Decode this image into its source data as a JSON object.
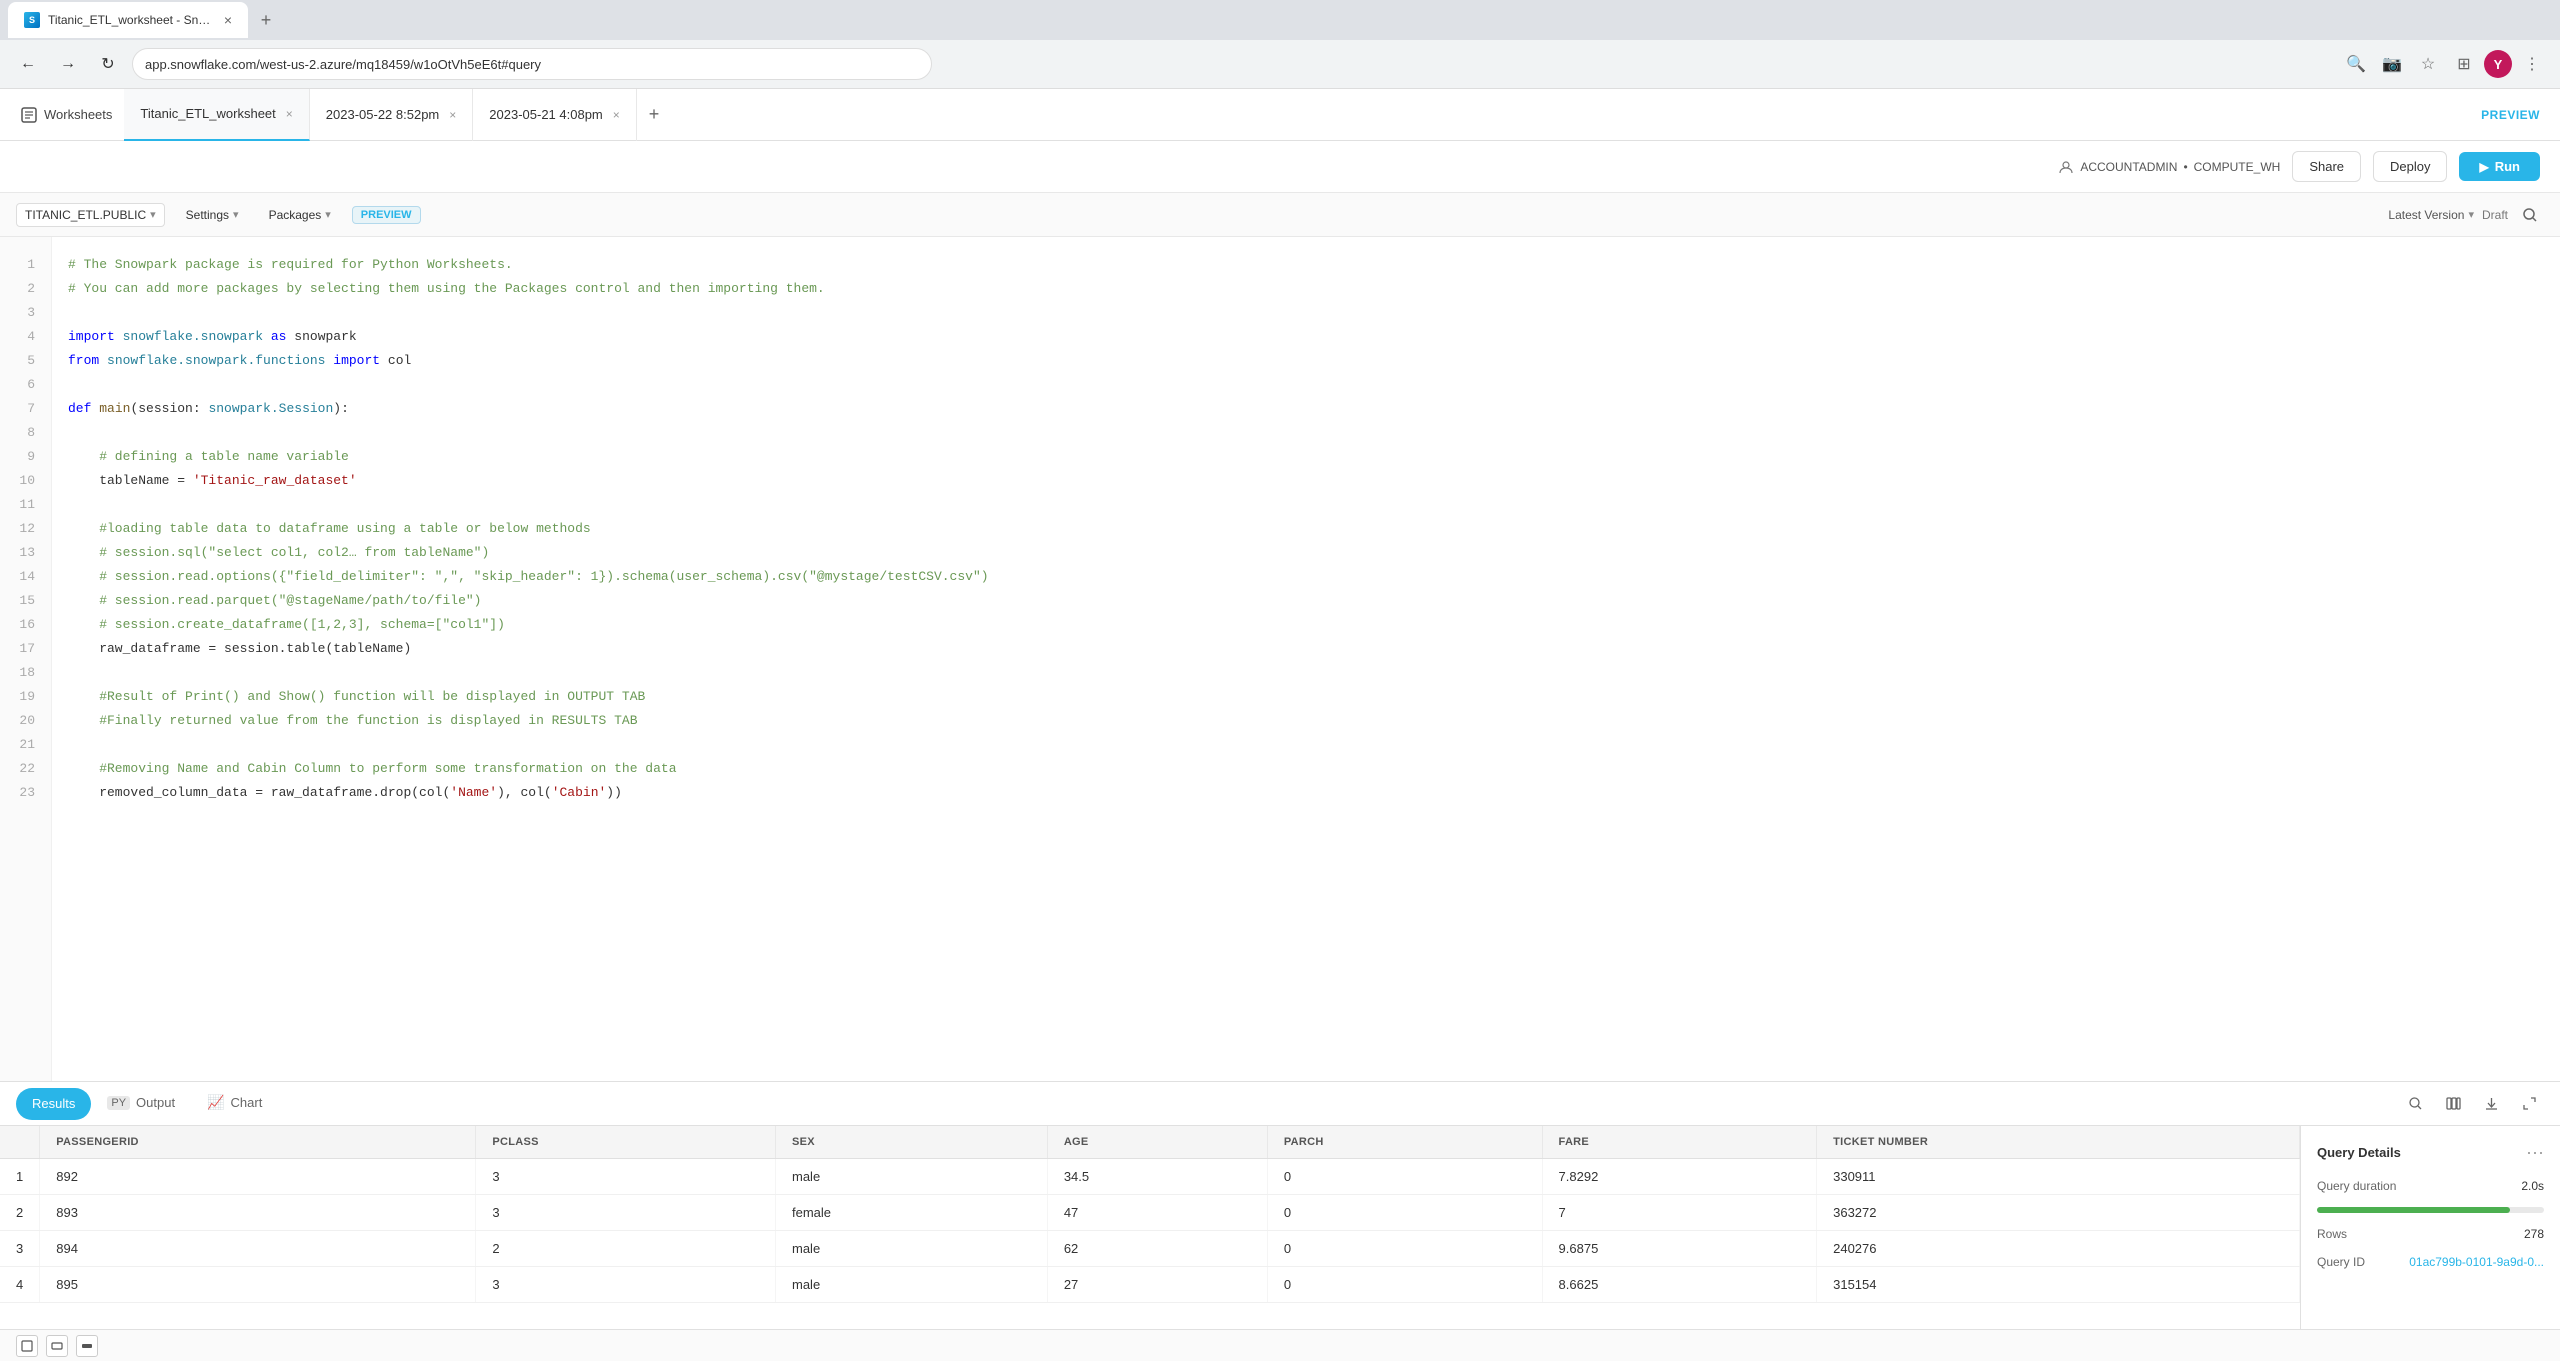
{
  "browser": {
    "tab_title": "Titanic_ETL_worksheet - Snowfla...",
    "tab_close": "×",
    "new_tab": "+",
    "url": "app.snowflake.com/west-us-2.azure/mq18459/w1oOtVh5eE6t#query",
    "nav_back": "←",
    "nav_forward": "→",
    "nav_refresh": "↻"
  },
  "app_toolbar": {
    "worksheets_label": "Worksheets",
    "tab1_label": "Titanic_ETL_worksheet",
    "tab2_label": "2023-05-22 8:52pm",
    "tab3_label": "2023-05-21 4:08pm",
    "add_tab": "+",
    "preview_label": "PREVIEW"
  },
  "action_bar": {
    "role": "ACCOUNTADMIN",
    "separator": "•",
    "warehouse": "COMPUTE_WH",
    "share_label": "Share",
    "deploy_label": "Deploy",
    "run_label": "Run",
    "run_icon": "▶"
  },
  "editor_toolbar": {
    "schema": "TITANIC_ETL.PUBLIC",
    "settings": "Settings",
    "packages": "Packages",
    "preview_badge": "PREVIEW",
    "version_label": "Latest Version",
    "draft_label": "Draft"
  },
  "code": {
    "lines": [
      {
        "num": 1,
        "text": "# The Snowpark package is required for Python Worksheets.",
        "type": "comment"
      },
      {
        "num": 2,
        "text": "# You can add more packages by selecting them using the Packages control and then importing them.",
        "type": "comment"
      },
      {
        "num": 3,
        "text": "",
        "type": "normal"
      },
      {
        "num": 4,
        "text": "import snowflake.snowpark as snowpark",
        "type": "import"
      },
      {
        "num": 5,
        "text": "from snowflake.snowpark.functions import col",
        "type": "import"
      },
      {
        "num": 6,
        "text": "",
        "type": "normal"
      },
      {
        "num": 7,
        "text": "def main(session: snowpark.Session):",
        "type": "def"
      },
      {
        "num": 8,
        "text": "",
        "type": "normal"
      },
      {
        "num": 9,
        "text": "    # defining a table name variable",
        "type": "comment"
      },
      {
        "num": 10,
        "text": "    tableName = 'Titanic_raw_dataset'",
        "type": "normal"
      },
      {
        "num": 11,
        "text": "",
        "type": "normal"
      },
      {
        "num": 12,
        "text": "    #loading table data to dataframe using a table or below methods",
        "type": "comment"
      },
      {
        "num": 13,
        "text": "    # session.sql(\"select col1, col2… from tableName\")",
        "type": "comment"
      },
      {
        "num": 14,
        "text": "    # session.read.options({\"field_delimiter\": \",\", \"skip_header\": 1}).schema(user_schema).csv(\"@mystage/testCSV.csv\")",
        "type": "comment"
      },
      {
        "num": 15,
        "text": "    # session.read.parquet(\"@stageName/path/to/file\")",
        "type": "comment"
      },
      {
        "num": 16,
        "text": "    # session.create_dataframe([1,2,3], schema=[\"col1\"])",
        "type": "comment"
      },
      {
        "num": 17,
        "text": "    raw_dataframe = session.table(tableName)",
        "type": "normal"
      },
      {
        "num": 18,
        "text": "",
        "type": "normal"
      },
      {
        "num": 19,
        "text": "    #Result of Print() and Show() function will be displayed in OUTPUT TAB",
        "type": "comment"
      },
      {
        "num": 20,
        "text": "    #Finally returned value from the function is displayed in RESULTS TAB",
        "type": "comment"
      },
      {
        "num": 21,
        "text": "",
        "type": "normal"
      },
      {
        "num": 22,
        "text": "    #Removing Name and Cabin Column to perform some transformation on the data",
        "type": "comment"
      },
      {
        "num": 23,
        "text": "    removed_column_data = raw_dataframe.drop(col('Name'), col('Cabin'))",
        "type": "normal"
      }
    ]
  },
  "results_tabs": {
    "results_label": "Results",
    "output_label": "Output",
    "output_icon": "PY",
    "chart_label": "Chart",
    "chart_icon": "📈"
  },
  "table": {
    "columns": [
      "PASSENGERID",
      "PCLASS",
      "SEX",
      "AGE",
      "PARCH",
      "FARE",
      "TICKET NUMBER"
    ],
    "rows": [
      {
        "rownum": 1,
        "passengerid": "892",
        "pclass": "3",
        "sex": "male",
        "age": "34.5",
        "parch": "0",
        "fare": "7.8292",
        "ticket": "330911"
      },
      {
        "rownum": 2,
        "passengerid": "893",
        "pclass": "3",
        "sex": "female",
        "age": "47",
        "parch": "0",
        "fare": "7",
        "ticket": "363272"
      },
      {
        "rownum": 3,
        "passengerid": "894",
        "pclass": "2",
        "sex": "male",
        "age": "62",
        "parch": "0",
        "fare": "9.6875",
        "ticket": "240276"
      },
      {
        "rownum": 4,
        "passengerid": "895",
        "pclass": "3",
        "sex": "male",
        "age": "27",
        "parch": "0",
        "fare": "8.6625",
        "ticket": "315154"
      }
    ]
  },
  "query_details": {
    "title": "Query Details",
    "menu_icon": "···",
    "duration_label": "Query duration",
    "duration_value": "2.0s",
    "rows_label": "Rows",
    "rows_value": "278",
    "query_id_label": "Query ID",
    "query_id_value": "01ac799b-0101-9a9d-0..."
  },
  "bottom_toolbar": {
    "btn1": "□",
    "btn2": "▭",
    "btn3": "▬"
  },
  "colors": {
    "accent": "#29b5e8",
    "green": "#4caf50"
  }
}
